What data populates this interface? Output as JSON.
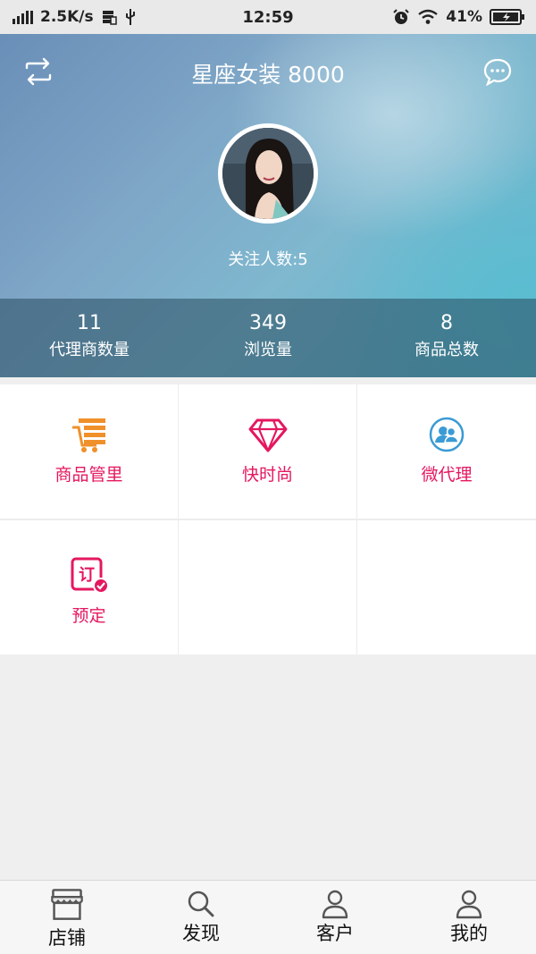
{
  "status_bar": {
    "speed": "2.5K/s",
    "time": "12:59",
    "battery": "41%"
  },
  "header": {
    "title": "星座女装 8000",
    "followers": "关注人数:5"
  },
  "stats": [
    {
      "value": "11",
      "label": "代理商数量"
    },
    {
      "value": "349",
      "label": "浏览量"
    },
    {
      "value": "8",
      "label": "商品总数"
    }
  ],
  "grid": [
    {
      "label": "商品管里",
      "icon": "cart-list-icon",
      "color": "#f0902a"
    },
    {
      "label": "快时尚",
      "icon": "diamond-icon",
      "color": "#e5175f"
    },
    {
      "label": "微代理",
      "icon": "people-circle-icon",
      "color": "#3a9bd5"
    },
    {
      "label": "预定",
      "icon": "order-check-icon",
      "color": "#e5175f",
      "glyph": "订"
    }
  ],
  "tabs": [
    {
      "label": "店铺",
      "icon": "store-icon"
    },
    {
      "label": "发现",
      "icon": "search-icon"
    },
    {
      "label": "客户",
      "icon": "person-icon"
    },
    {
      "label": "我的",
      "icon": "user-icon"
    }
  ],
  "colors": {
    "accent": "#e5175f",
    "orange": "#f0902a",
    "blue": "#3a9bd5"
  }
}
